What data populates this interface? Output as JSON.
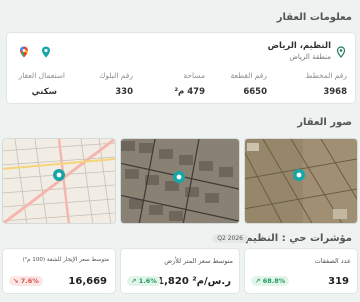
{
  "property": {
    "section_title": "معلومات العقار",
    "district_city": "النظيم، الرياض",
    "region": "منطقة الرياض",
    "fields": [
      {
        "label": "رقم المخطط",
        "value": "3968"
      },
      {
        "label": "رقم القطعة",
        "value": "6650"
      },
      {
        "label": "مساحة",
        "value": "479 م²"
      },
      {
        "label": "رقم البلوك",
        "value": "330"
      },
      {
        "label": "استعمال العقار",
        "value": "سكني"
      }
    ]
  },
  "images": {
    "section_title": "صور العقار"
  },
  "indicators": {
    "section_title": "مؤشرات حي : النظيم",
    "period_badge": "Q2 2026",
    "cards": [
      {
        "title": "عدد الصفقات",
        "value": "319",
        "change": "68.8%",
        "trend": "up"
      },
      {
        "title": "متوسط سعر المتر للأرض",
        "value": "1,820 ر.س/م²",
        "change": "1.6%",
        "trend": "up"
      },
      {
        "title": "متوسط سعر الإيجار للشقة (100 م²)",
        "value": "16,669",
        "change": "7.6%",
        "trend": "down"
      }
    ]
  },
  "colors": {
    "accent": "#17a6a8",
    "brand_green": "#1b7f58",
    "up": "#1f9a5a",
    "down": "#d9534f"
  }
}
